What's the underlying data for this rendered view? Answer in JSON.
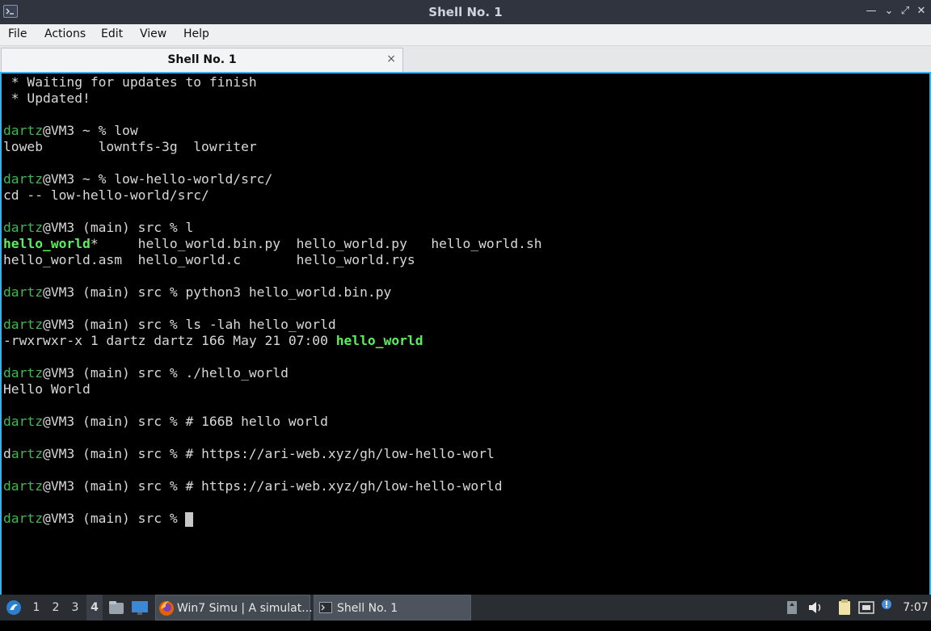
{
  "window": {
    "title": "Shell No. 1",
    "controls": [
      "—",
      "⌄",
      "⤢",
      "✕"
    ]
  },
  "menu": [
    "File",
    "Actions",
    "Edit",
    "View",
    "Help"
  ],
  "tab": {
    "label": "Shell No. 1",
    "close": "×"
  },
  "terminal": {
    "lines": [
      [
        {
          "t": " * Waiting for updates to finish"
        }
      ],
      [
        {
          "t": " * Updated!"
        }
      ],
      [],
      [
        {
          "t": "dartz",
          "c": "g"
        },
        {
          "t": "@VM3 ~ % low"
        }
      ],
      [
        {
          "t": "loweb       lowntfs-3g  lowriter"
        }
      ],
      [],
      [
        {
          "t": "dartz",
          "c": "g"
        },
        {
          "t": "@VM3 ~ % low-hello-world/src/"
        }
      ],
      [
        {
          "t": "cd -- low-hello-world/src/"
        }
      ],
      [],
      [
        {
          "t": "dartz",
          "c": "g"
        },
        {
          "t": "@VM3 (main) src % l"
        }
      ],
      [
        {
          "t": "hello_world",
          "c": "gb"
        },
        {
          "t": "*     hello_world.bin.py  hello_world.py   hello_world.sh"
        }
      ],
      [
        {
          "t": "hello_world.asm  hello_world.c       hello_world.rys"
        }
      ],
      [],
      [
        {
          "t": "dartz",
          "c": "g"
        },
        {
          "t": "@VM3 (main) src % python3 hello_world.bin.py"
        }
      ],
      [],
      [
        {
          "t": "dartz",
          "c": "g"
        },
        {
          "t": "@VM3 (main) src % ls -lah hello_world"
        }
      ],
      [
        {
          "t": "-rwxrwxr-x 1 dartz dartz 166 May 21 07:00 "
        },
        {
          "t": "hello_world",
          "c": "gb"
        }
      ],
      [],
      [
        {
          "t": "dartz",
          "c": "g"
        },
        {
          "t": "@VM3 (main) src % ./hello_world"
        }
      ],
      [
        {
          "t": "Hello World"
        }
      ],
      [],
      [
        {
          "t": "dartz",
          "c": "g"
        },
        {
          "t": "@VM3 (main) src % # 166B hello world"
        }
      ],
      [],
      [
        {
          "t": "d"
        },
        {
          "t": "artz",
          "c": "g"
        },
        {
          "t": "@VM3 (main) src % # https://ari-web.xyz/gh/low-hello-worl"
        }
      ],
      [],
      [
        {
          "t": "dartz",
          "c": "g"
        },
        {
          "t": "@VM3 (main) src % # https://ari-web.xyz/gh/low-hello-world"
        }
      ],
      [],
      [
        {
          "t": "dartz",
          "c": "g"
        },
        {
          "t": "@VM3 (main) src % "
        },
        {
          "cursor": true
        }
      ]
    ]
  },
  "taskbar": {
    "workspaces": [
      "1",
      "2",
      "3",
      "4"
    ],
    "active_workspace": "4",
    "tasks": [
      {
        "label": "Win7 Simu | A simulat...",
        "icon": "firefox-icon"
      },
      {
        "label": "Shell No. 1",
        "icon": "terminal-icon",
        "active": true
      }
    ],
    "clock": "7:07"
  }
}
